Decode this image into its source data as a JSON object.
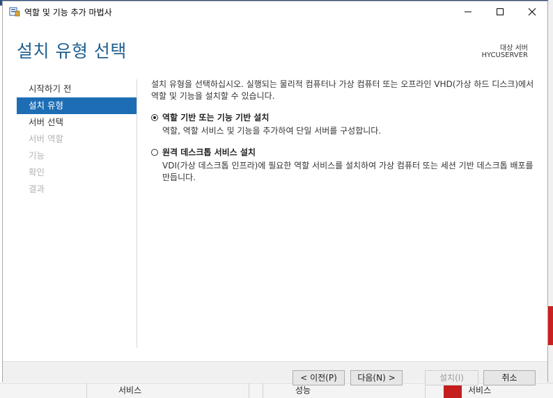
{
  "window": {
    "title": "역할 및 기능 추가 마법사",
    "icon": "server-manager-icon"
  },
  "header": {
    "title": "설치 유형 선택",
    "destination_label": "대상 서버",
    "destination_server": "HYCUSERVER"
  },
  "nav": {
    "items": [
      {
        "label": "시작하기 전",
        "state": "normal"
      },
      {
        "label": "설치 유형",
        "state": "active"
      },
      {
        "label": "서버 선택",
        "state": "normal"
      },
      {
        "label": "서버 역할",
        "state": "disabled"
      },
      {
        "label": "기능",
        "state": "disabled"
      },
      {
        "label": "확인",
        "state": "disabled"
      },
      {
        "label": "결과",
        "state": "disabled"
      }
    ]
  },
  "content": {
    "intro": "설치 유형을 선택하십시오. 실행되는 물리적 컴퓨터나 가상 컴퓨터 또는 오프라인 VHD(가상 하드 디스크)에서 역할 및 기능을 설치할 수 있습니다.",
    "options": [
      {
        "title": "역할 기반 또는 기능 기반 설치",
        "description": "역할, 역할 서비스 및 기능을 추가하여 단일 서버를 구성합니다.",
        "selected": true
      },
      {
        "title": "원격 데스크톱 서비스 설치",
        "description": "VDI(가상 데스크톱 인프라)에 필요한 역할 서비스를 설치하여 가상 컴퓨터 또는 세션 기반 데스크톱 배포를 만듭니다.",
        "selected": false
      }
    ]
  },
  "buttons": {
    "previous": "< 이전(P)",
    "next": "다음(N) >",
    "install": "설치(I)",
    "cancel": "취소"
  },
  "background": {
    "cells": [
      "서비스",
      "성능",
      "서비스"
    ]
  }
}
